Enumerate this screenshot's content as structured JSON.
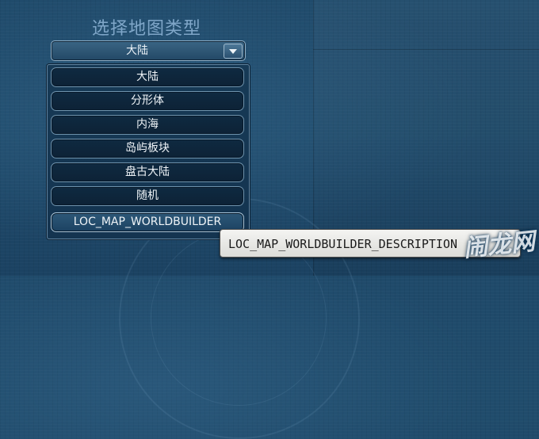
{
  "title": "选择地图类型",
  "select": {
    "value": "大陆"
  },
  "options": [
    {
      "label": "大陆"
    },
    {
      "label": "分形体"
    },
    {
      "label": "内海"
    },
    {
      "label": "岛屿板块"
    },
    {
      "label": "盘古大陆"
    },
    {
      "label": "随机"
    },
    {
      "label": "LOC_MAP_WORLDBUILDER"
    }
  ],
  "selected_option": "LOC_MAP_WORLDBUILDER",
  "tooltip": "LOC_MAP_WORLDBUILDER_DESCRIPTION",
  "watermark": "闹龙网"
}
